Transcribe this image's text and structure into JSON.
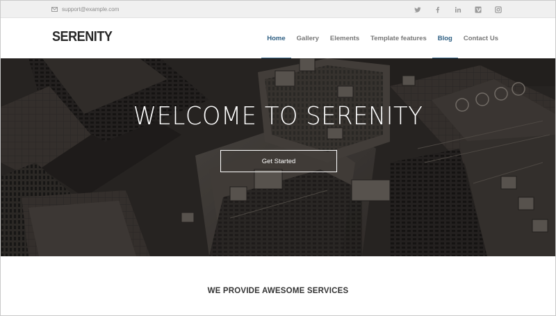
{
  "topbar": {
    "email": "support@example.com",
    "social": [
      "twitter-icon",
      "facebook-icon",
      "linkedin-icon",
      "vimeo-icon",
      "instagram-icon"
    ]
  },
  "header": {
    "logo": "SERENITY",
    "nav": [
      {
        "label": "Home",
        "active": true
      },
      {
        "label": "Gallery",
        "active": false
      },
      {
        "label": "Elements",
        "active": false
      },
      {
        "label": "Template features",
        "active": false
      },
      {
        "label": "Blog",
        "active": true
      },
      {
        "label": "Contact Us",
        "active": false
      }
    ]
  },
  "hero": {
    "title": "WELCOME TO SERENITY",
    "button": "Get Started"
  },
  "services": {
    "title": "WE PROVIDE AWESOME SERVICES"
  },
  "colors": {
    "accent": "#2e5f83",
    "topbar_bg": "#f0f0f0",
    "hero_base": "#2a2624"
  }
}
